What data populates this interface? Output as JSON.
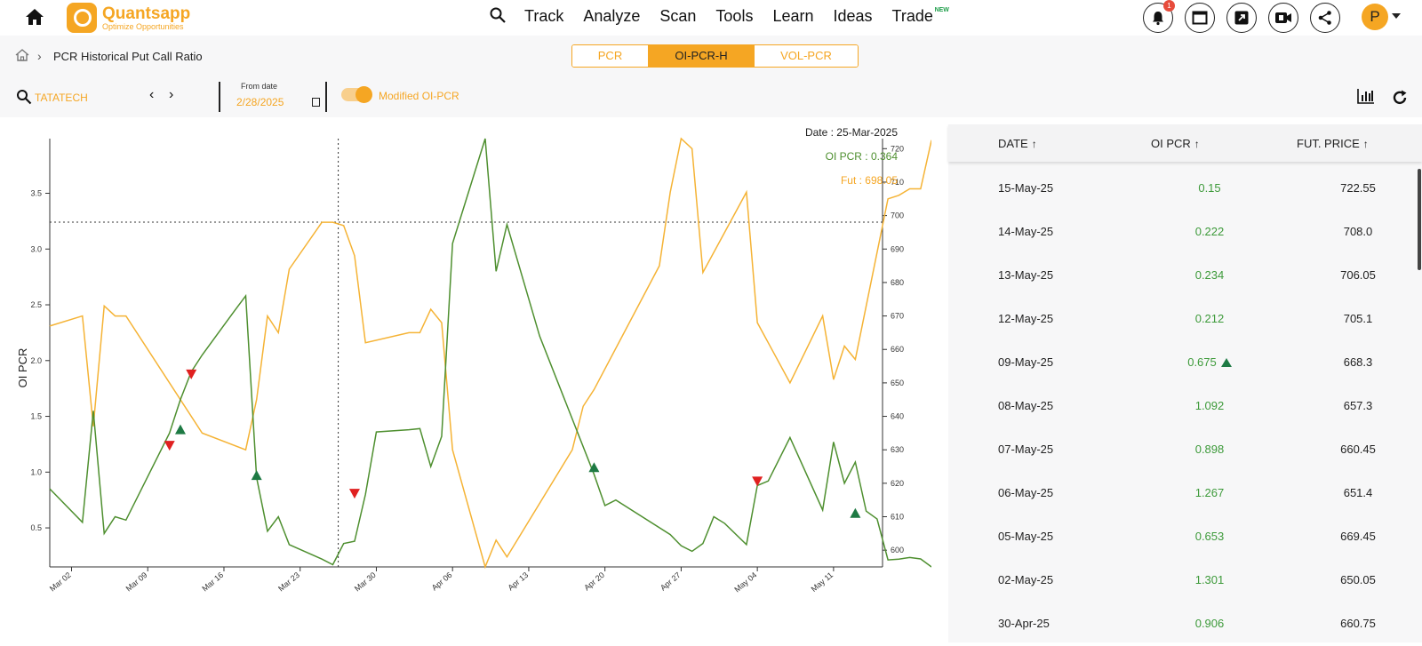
{
  "app": {
    "brand": "Quantsapp",
    "tagline": "Optimize Opportunities",
    "nav": [
      "Track",
      "Analyze",
      "Scan",
      "Tools",
      "Learn",
      "Ideas",
      "Trade"
    ],
    "trade_badge": "NEW",
    "notification_count": "1",
    "user_initial": "P"
  },
  "breadcrumb": {
    "page_title": "PCR Historical Put Call Ratio"
  },
  "tabs": [
    {
      "label": "PCR",
      "active": false
    },
    {
      "label": "OI-PCR-H",
      "active": true
    },
    {
      "label": "VOL-PCR",
      "active": false
    }
  ],
  "toolbar": {
    "symbol": "TATATECH",
    "from_label": "From date",
    "from_date": "2/28/2025",
    "toggle_label": "Modified OI-PCR",
    "toggle_on": true
  },
  "tooltip": {
    "date": "Date : 25-Mar-2025",
    "oi_pcr": "OI PCR : 0.364",
    "fut": "Fut : 698.05"
  },
  "colors": {
    "accent": "#f5a623",
    "oi_pcr_line": "#4e8f2f",
    "fut_line": "#f5b335",
    "up_marker": "#1e7a44",
    "down_marker": "#e02020"
  },
  "chart_data": {
    "type": "line",
    "ylabel": "OI PCR",
    "x_ticks": [
      "Mar 02",
      "Mar 09",
      "Mar 16",
      "Mar 23",
      "Mar 30",
      "Apr 06",
      "Apr 13",
      "Apr 20",
      "Apr 27",
      "May 04",
      "May 11"
    ],
    "y_left_ticks": [
      "0.5",
      "1.0",
      "1.5",
      "2.0",
      "2.5",
      "3.0",
      "3.5"
    ],
    "y_right_ticks": [
      "600",
      "610",
      "620",
      "630",
      "640",
      "650",
      "660",
      "670",
      "680",
      "690",
      "700",
      "710",
      "720"
    ],
    "ylim_left": [
      0.15,
      3.99
    ],
    "ylim_right": [
      595,
      723
    ],
    "x_range_days": [
      -1,
      75.5
    ],
    "series": [
      {
        "name": "OI PCR",
        "axis": "left",
        "points": [
          [
            -1,
            0.85
          ],
          [
            2,
            0.55
          ],
          [
            3,
            1.55
          ],
          [
            4,
            0.45
          ],
          [
            5,
            0.6
          ],
          [
            6,
            0.57
          ],
          [
            10,
            1.35
          ],
          [
            11,
            1.65
          ],
          [
            12,
            1.9
          ],
          [
            13,
            2.05
          ],
          [
            16,
            2.45
          ],
          [
            17,
            2.58
          ],
          [
            18,
            0.95
          ],
          [
            19,
            0.47
          ],
          [
            20,
            0.6
          ],
          [
            21,
            0.35
          ],
          [
            24,
            0.22
          ],
          [
            25,
            0.17
          ],
          [
            26,
            0.36
          ],
          [
            27,
            0.38
          ],
          [
            28,
            0.8
          ],
          [
            29,
            1.36
          ],
          [
            32,
            1.38
          ],
          [
            33,
            1.39
          ],
          [
            34,
            1.05
          ],
          [
            35,
            1.32
          ],
          [
            36,
            3.05
          ],
          [
            39,
            3.99
          ],
          [
            40,
            2.8
          ],
          [
            41,
            3.22
          ],
          [
            44,
            2.22
          ],
          [
            49,
            0.98
          ],
          [
            50,
            0.7
          ],
          [
            51,
            0.75
          ],
          [
            56,
            0.44
          ],
          [
            57,
            0.34
          ],
          [
            58,
            0.29
          ],
          [
            59,
            0.36
          ],
          [
            60,
            0.6
          ],
          [
            61,
            0.54
          ],
          [
            63,
            0.35
          ],
          [
            64,
            0.88
          ],
          [
            65,
            0.92
          ],
          [
            67,
            1.31
          ],
          [
            70,
            0.66
          ],
          [
            71,
            1.27
          ],
          [
            72,
            0.9
          ],
          [
            73,
            1.09
          ],
          [
            74,
            0.65
          ],
          [
            75,
            0.58
          ],
          [
            76,
            0.213
          ],
          [
            77,
            0.22
          ],
          [
            78,
            0.235
          ],
          [
            79,
            0.222
          ],
          [
            80,
            0.15
          ]
        ]
      },
      {
        "name": "Fut",
        "axis": "right",
        "points": [
          [
            -1,
            667
          ],
          [
            2,
            670
          ],
          [
            3,
            637
          ],
          [
            4,
            673
          ],
          [
            5,
            670
          ],
          [
            6,
            670
          ],
          [
            13,
            635
          ],
          [
            17,
            630
          ],
          [
            18,
            645
          ],
          [
            19,
            670
          ],
          [
            20,
            665
          ],
          [
            21,
            684
          ],
          [
            24,
            698
          ],
          [
            25,
            698
          ],
          [
            26,
            697
          ],
          [
            27,
            688
          ],
          [
            28,
            662
          ],
          [
            32,
            665
          ],
          [
            33,
            665
          ],
          [
            34,
            672
          ],
          [
            35,
            668
          ],
          [
            36,
            630
          ],
          [
            39,
            595
          ],
          [
            40,
            603
          ],
          [
            41,
            598
          ],
          [
            47,
            630
          ],
          [
            48,
            643
          ],
          [
            49,
            648
          ],
          [
            55,
            685
          ],
          [
            56,
            707
          ],
          [
            57,
            723
          ],
          [
            58,
            720
          ],
          [
            59,
            683
          ],
          [
            63,
            707
          ],
          [
            64,
            668
          ],
          [
            65,
            662
          ],
          [
            67,
            650
          ],
          [
            70,
            670
          ],
          [
            71,
            651
          ],
          [
            72,
            661
          ],
          [
            73,
            657
          ],
          [
            76,
            705
          ],
          [
            77,
            706.05
          ],
          [
            78,
            708
          ],
          [
            79,
            708
          ],
          [
            80,
            722.55
          ]
        ]
      }
    ],
    "up_markers": [
      [
        11,
        1.38
      ],
      [
        18,
        0.97
      ],
      [
        49,
        1.04
      ],
      [
        73,
        0.63
      ]
    ],
    "down_markers": [
      [
        10,
        1.24
      ],
      [
        12,
        1.88
      ],
      [
        27,
        0.81
      ],
      [
        64,
        0.92
      ]
    ],
    "crosshair": {
      "x": 25.5,
      "fut": 698.05
    }
  },
  "table": {
    "headers": {
      "date": "DATE",
      "oi_pcr": "OI PCR",
      "fut_price": "FUT. PRICE"
    },
    "sort_arrow": "↑",
    "rows": [
      {
        "date": "15-May-25",
        "oi_pcr": "0.15",
        "fut": "722.55",
        "up": false
      },
      {
        "date": "14-May-25",
        "oi_pcr": "0.222",
        "fut": "708.0",
        "up": false
      },
      {
        "date": "13-May-25",
        "oi_pcr": "0.234",
        "fut": "706.05",
        "up": false
      },
      {
        "date": "12-May-25",
        "oi_pcr": "0.212",
        "fut": "705.1",
        "up": false
      },
      {
        "date": "09-May-25",
        "oi_pcr": "0.675",
        "fut": "668.3",
        "up": true
      },
      {
        "date": "08-May-25",
        "oi_pcr": "1.092",
        "fut": "657.3",
        "up": false
      },
      {
        "date": "07-May-25",
        "oi_pcr": "0.898",
        "fut": "660.45",
        "up": false
      },
      {
        "date": "06-May-25",
        "oi_pcr": "1.267",
        "fut": "651.4",
        "up": false
      },
      {
        "date": "05-May-25",
        "oi_pcr": "0.653",
        "fut": "669.45",
        "up": false
      },
      {
        "date": "02-May-25",
        "oi_pcr": "1.301",
        "fut": "650.05",
        "up": false
      },
      {
        "date": "30-Apr-25",
        "oi_pcr": "0.906",
        "fut": "660.75",
        "up": false
      }
    ]
  }
}
